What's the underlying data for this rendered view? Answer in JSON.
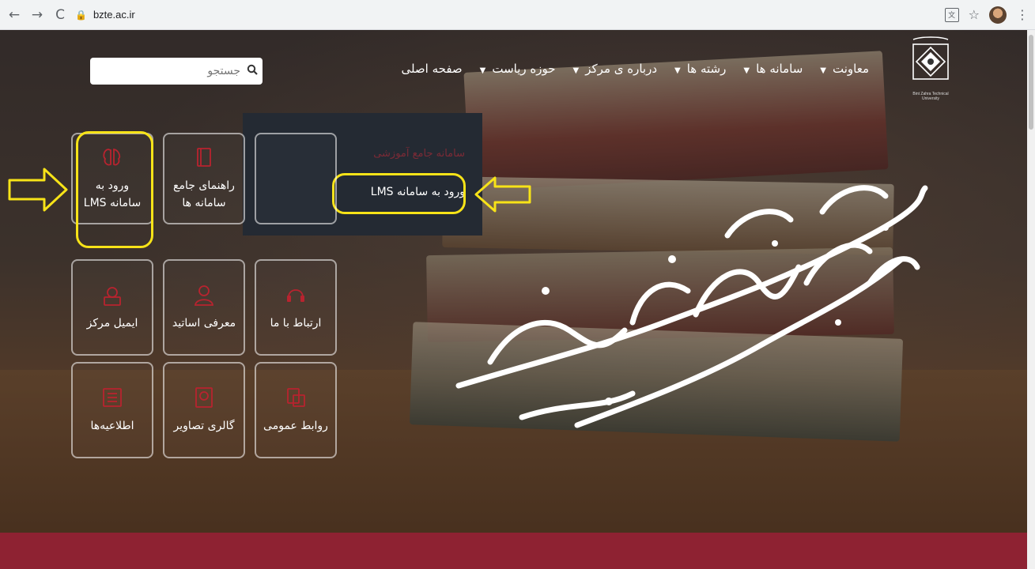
{
  "browser": {
    "url": "bzte.ac.ir",
    "back_icon": "arrow-left-icon",
    "forward_icon": "arrow-right-icon",
    "reload_icon": "reload-icon",
    "back_glyph": "←",
    "forward_glyph": "→",
    "reload_glyph": "C",
    "translate_glyph": "文",
    "bookmark_glyph": "☆",
    "menu_glyph": "⋮"
  },
  "header": {
    "logo_caption_line1": "Bint Zahra Technical",
    "logo_caption_line2": "University",
    "nav": [
      "صفحه اصلی",
      "حوزه ریاست",
      "درباره ی مرکز",
      "رشته ها",
      "سامانه ها",
      "معاونت"
    ],
    "search_placeholder": "جستجو"
  },
  "dropdown": {
    "heading": "سامانه جامع آموزشی",
    "lms_link": "ورود به سامانه LMS"
  },
  "tiles": [
    {
      "line1": "ورود به",
      "line2": "سامانه LMS",
      "icon": "brain-icon"
    },
    {
      "line1": "راهنمای جامع",
      "line2": "سامانه ها",
      "icon": "book-icon"
    },
    {
      "line1": "ایمیل مرکز",
      "line2": "",
      "icon": "email-icon"
    },
    {
      "line1": "معرفی اساتید",
      "line2": "",
      "icon": "user-icon"
    },
    {
      "line1": "ارتباط با ما",
      "line2": "",
      "icon": "headset-icon"
    },
    {
      "line1": "اطلاعیه‌ها",
      "line2": "",
      "icon": "list-icon"
    },
    {
      "line1": "گالری تصاویر",
      "line2": "",
      "icon": "image-icon"
    },
    {
      "line1": "روابط عمومی",
      "line2": "",
      "icon": "document-icon"
    }
  ],
  "colors": {
    "highlight": "#f7e318",
    "footer_band": "#8e2232",
    "dropdown_bg": "#242a33",
    "icon_red": "#b8232f"
  }
}
